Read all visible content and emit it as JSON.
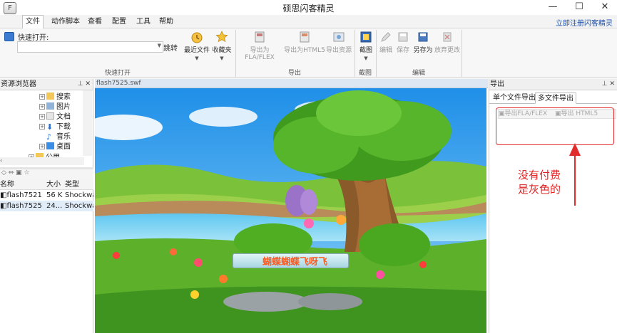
{
  "window": {
    "title": "硕思闪客精灵",
    "app_icon_letter": "F",
    "minimize": "—",
    "maximize": "☐",
    "close": "✕"
  },
  "menu": {
    "items": [
      "文件",
      "动作脚本",
      "查看",
      "配置",
      "工具",
      "帮助"
    ],
    "register": "立即注册闪客精灵"
  },
  "ribbon": {
    "quick_open_label": "快速打开:",
    "quick_open_value": "",
    "jump": "跳转",
    "recent": "最近文件",
    "favorites": "收藏夹",
    "group_quick": "快速打开",
    "export_fla": "导出为FLA/FLEX",
    "export_html5": "导出为HTML5",
    "export_resources": "导出资源",
    "group_export": "导出",
    "screenshot": "截图",
    "group_screenshot": "截图",
    "edit": "编辑",
    "save": "保存",
    "save_as": "另存为",
    "discard": "放弃更改",
    "group_edit": "编辑"
  },
  "left_panel": {
    "title": "资源浏览器",
    "pins": "⊥ ✕",
    "tree": [
      "搜索",
      "图片",
      "文档",
      "下载",
      "音乐",
      "桌面",
      "公用"
    ],
    "file_columns": [
      "名称",
      "大小",
      "类型"
    ],
    "files": [
      {
        "name": "flash7521",
        "size": "56 K",
        "type": "Shockwa"
      },
      {
        "name": "flash7525",
        "size": "24...",
        "type": "Shockwa"
      }
    ]
  },
  "document": {
    "tab": "flash7525.swf",
    "caption": "蝴蝶蝴蝶飞呀飞"
  },
  "right_panel": {
    "title": "导出",
    "pins": "⊥ ✕",
    "tabs": [
      "单个文件导出",
      "多文件导出"
    ],
    "toolbar_fla": "导出FLA/FLEX",
    "toolbar_html5": "导出 HTML5",
    "annotation": "没有付费\n是灰色的"
  },
  "colors": {
    "annotation_red": "#e22b2b",
    "register_blue": "#1b4ea8",
    "sky": "#3aa6f0",
    "grass": "#6fbf2a"
  }
}
